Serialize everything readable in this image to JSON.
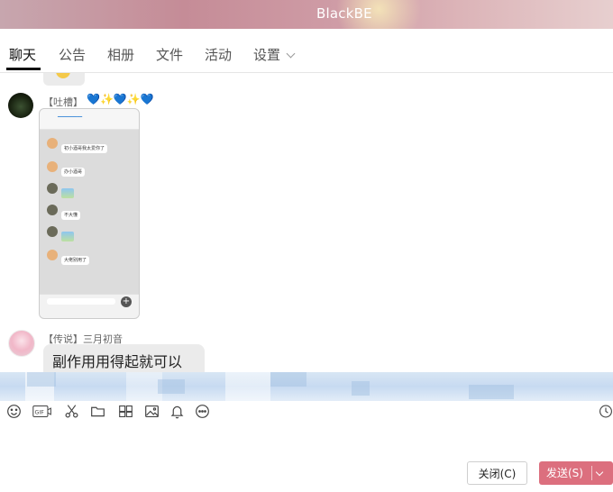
{
  "window": {
    "title": "BlackBE"
  },
  "tabs": [
    {
      "label": "聊天",
      "active": true
    },
    {
      "label": "公告"
    },
    {
      "label": "相册"
    },
    {
      "label": "文件"
    },
    {
      "label": "活动"
    },
    {
      "label": "设置"
    }
  ],
  "messages": [
    {
      "sender": "【吐槽】",
      "decoration": [
        "💙",
        "✨",
        "💙",
        "✨",
        "💙"
      ],
      "embedded_screenshot": {
        "messages": [
          "初小酒哥我太爱你了",
          "办小酒哥",
          "不大懂",
          "大佬别用了"
        ]
      }
    },
    {
      "sender": "【传说】三月初音",
      "text": "副作用用得起就可以"
    }
  ],
  "toolbar": {
    "icons": [
      "emoji-icon",
      "gif-icon",
      "scissors-icon",
      "folder-icon",
      "sticker-icon",
      "image-icon",
      "bell-icon",
      "more-icon",
      "history-icon"
    ],
    "gif_label": "GIF"
  },
  "buttons": {
    "close": "关闭(C)",
    "send": "发送(S)"
  },
  "colors": {
    "send_button": "#dc6f7e",
    "accent_blue": "#3b8de8"
  }
}
